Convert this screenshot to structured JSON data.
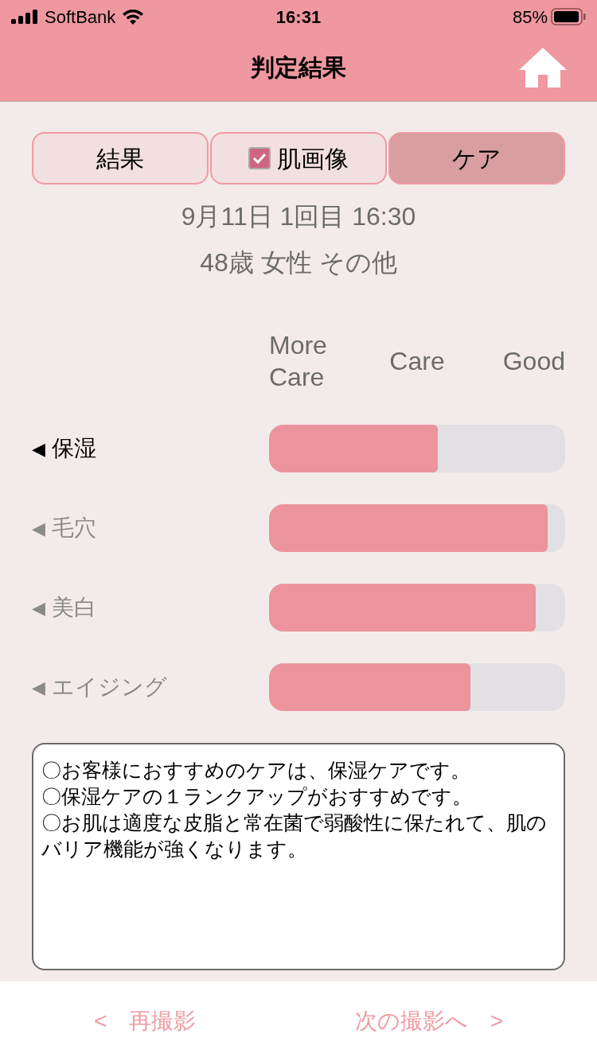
{
  "status_bar": {
    "carrier": "SoftBank",
    "time": "16:31",
    "battery": "85%"
  },
  "nav": {
    "title": "判定結果"
  },
  "tabs": [
    {
      "label": "結果",
      "selected": false,
      "kind": "plain"
    },
    {
      "label": "肌画像",
      "selected": false,
      "kind": "checkbox",
      "checked": true
    },
    {
      "label": "ケア",
      "selected": true,
      "kind": "plain"
    }
  ],
  "info": [
    "9月11日 1回目 16:30",
    "48歳 女性 その他"
  ],
  "scale_headers": [
    "More Care",
    "Care",
    "Good"
  ],
  "categories": [
    {
      "marker": "◀",
      "label": "保湿",
      "selected": true,
      "level": 0.57
    },
    {
      "marker": "◀",
      "label": "毛穴",
      "selected": false,
      "level": 0.94
    },
    {
      "marker": "◀",
      "label": "美白",
      "selected": false,
      "level": 0.9
    },
    {
      "marker": "◀",
      "label": "エイジング",
      "selected": false,
      "level": 0.68
    }
  ],
  "advice": [
    "〇お客様におすすめのケアは、保湿ケアです。",
    "〇保湿ケアの１ランクアップがおすすめです。",
    "〇お肌は適度な皮脂と常在菌で弱酸性に保たれて、肌のバリア機能が強くなります。"
  ],
  "footer": {
    "back": {
      "arrow": "<",
      "label": "再撮影"
    },
    "next": {
      "label": "次の撮影へ",
      "arrow": ">"
    }
  }
}
